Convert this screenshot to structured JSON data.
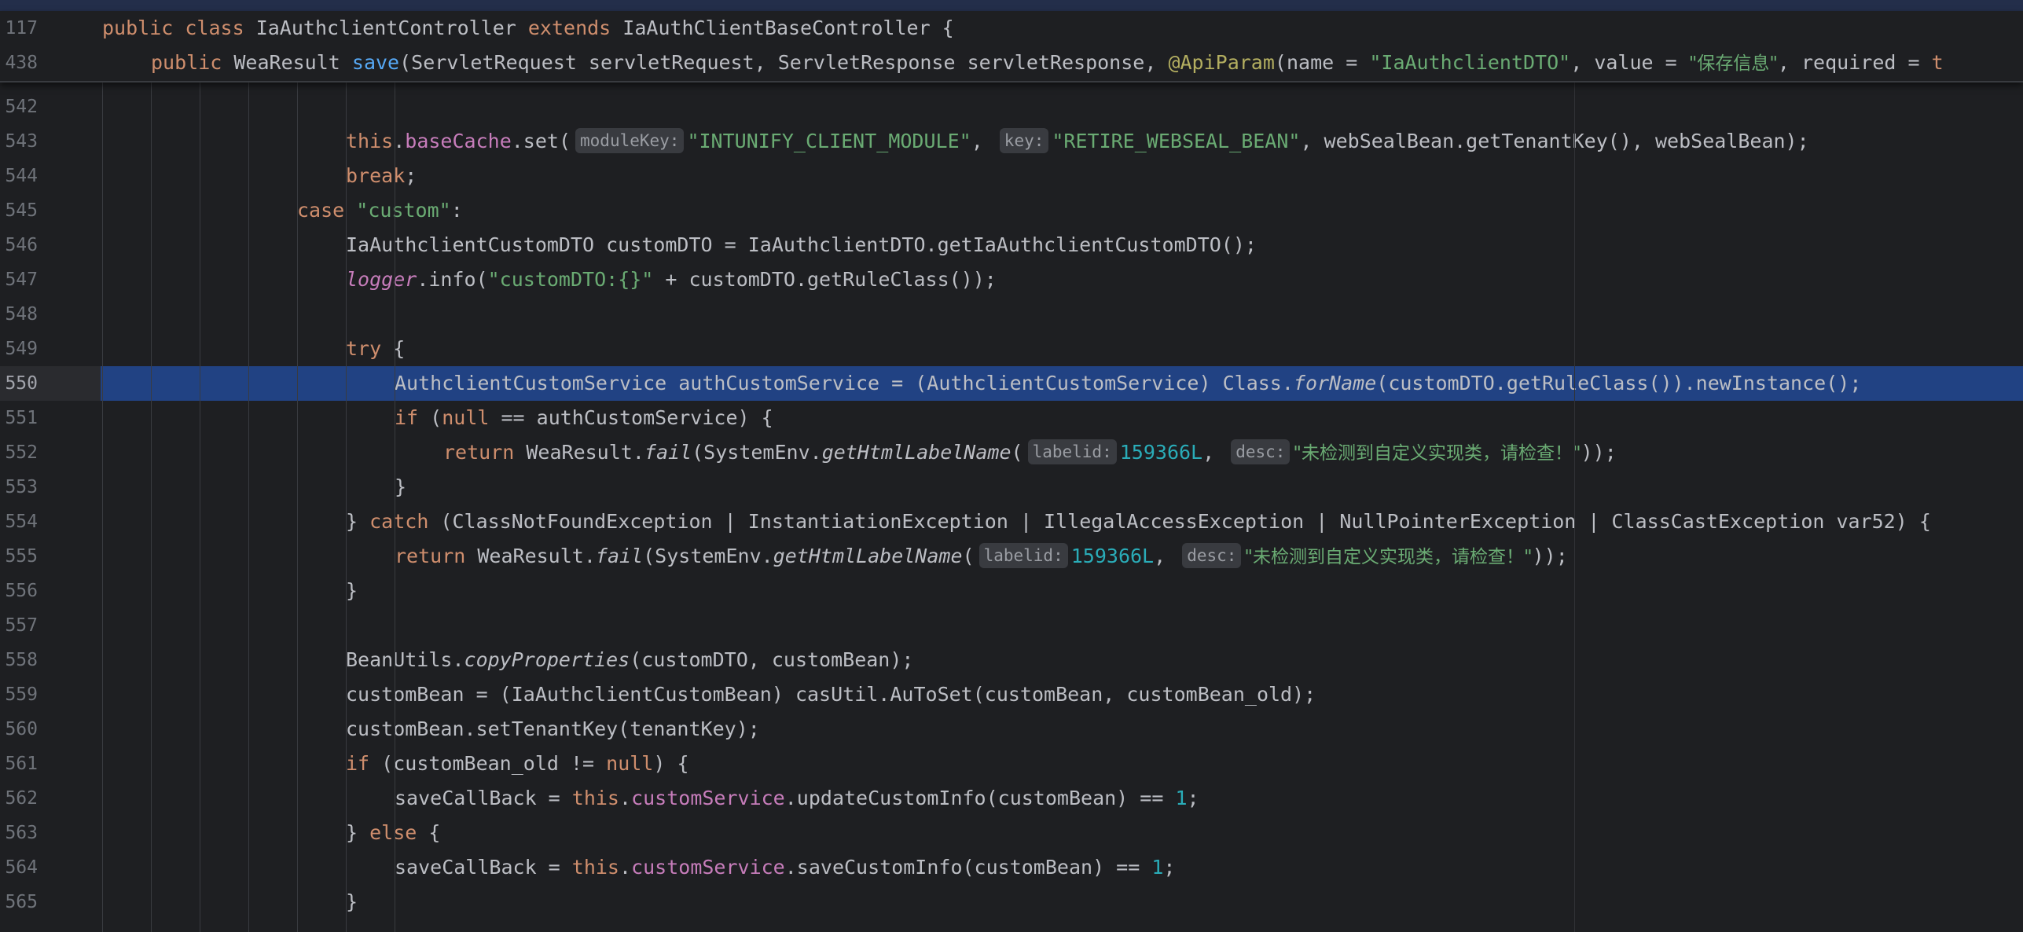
{
  "editor": {
    "sticky": [
      {
        "num": "117",
        "indent": 0,
        "parts": [
          {
            "t": "public",
            "c": "kw"
          },
          {
            "t": " "
          },
          {
            "t": "class",
            "c": "kw"
          },
          {
            "t": " IaAuthclientController "
          },
          {
            "t": "extends",
            "c": "kw"
          },
          {
            "t": " IaAuthClientBaseController {"
          }
        ]
      },
      {
        "num": "438",
        "indent": 1,
        "parts": [
          {
            "t": "public",
            "c": "kw"
          },
          {
            "t": " WeaResult "
          },
          {
            "t": "save",
            "c": "fn"
          },
          {
            "t": "(ServletRequest servletRequest, ServletResponse servletResponse, "
          },
          {
            "t": "@ApiParam",
            "c": "ann"
          },
          {
            "t": "(name = "
          },
          {
            "t": "\"IaAuthclientDTO\"",
            "c": "str"
          },
          {
            "t": ", value = "
          },
          {
            "t": "\"保存信息\"",
            "c": "str cn"
          },
          {
            "t": ", required = "
          },
          {
            "t": "t",
            "c": "kw"
          }
        ]
      }
    ],
    "lines": [
      {
        "num": "542",
        "indent": 0,
        "parts": []
      },
      {
        "num": "543",
        "indent": 5,
        "parts": [
          {
            "t": "this",
            "c": "kw"
          },
          {
            "t": "."
          },
          {
            "t": "baseCache",
            "c": "fld"
          },
          {
            "t": ".set("
          },
          {
            "h": "moduleKey:"
          },
          {
            "t": "\"INTUNIFY_CLIENT_MODULE\"",
            "c": "str"
          },
          {
            "t": ", "
          },
          {
            "h": "key:"
          },
          {
            "t": "\"RETIRE_WEBSEAL_BEAN\"",
            "c": "str"
          },
          {
            "t": ", webSealBean.getTenantKey(), webSealBean);"
          }
        ]
      },
      {
        "num": "544",
        "indent": 5,
        "parts": [
          {
            "t": "break",
            "c": "kw"
          },
          {
            "t": ";"
          }
        ]
      },
      {
        "num": "545",
        "indent": 4,
        "parts": [
          {
            "t": "case",
            "c": "kw"
          },
          {
            "t": " "
          },
          {
            "t": "\"custom\"",
            "c": "str"
          },
          {
            "t": ":"
          }
        ]
      },
      {
        "num": "546",
        "indent": 5,
        "parts": [
          {
            "t": "IaAuthclientCustomDTO customDTO = IaAuthclientDTO.getIaAuthclientCustomDTO();"
          }
        ]
      },
      {
        "num": "547",
        "indent": 5,
        "parts": [
          {
            "t": "logger",
            "c": "fld it"
          },
          {
            "t": ".info("
          },
          {
            "t": "\"customDTO:{}\"",
            "c": "str"
          },
          {
            "t": " + customDTO.getRuleClass());"
          }
        ]
      },
      {
        "num": "548",
        "indent": 0,
        "parts": []
      },
      {
        "num": "549",
        "indent": 5,
        "parts": [
          {
            "t": "try",
            "c": "kw"
          },
          {
            "t": " {"
          }
        ]
      },
      {
        "num": "550",
        "indent": 6,
        "hl": true,
        "parts": [
          {
            "t": "AuthclientCustomService authCustomService = (AuthclientCustomService) Class."
          },
          {
            "t": "forName",
            "c": "it"
          },
          {
            "t": "(customDTO.getRuleClass()).newInstance();"
          }
        ]
      },
      {
        "num": "551",
        "indent": 6,
        "parts": [
          {
            "t": "if",
            "c": "kw"
          },
          {
            "t": " ("
          },
          {
            "t": "null",
            "c": "kw"
          },
          {
            "t": " == authCustomService) {"
          }
        ]
      },
      {
        "num": "552",
        "indent": 7,
        "parts": [
          {
            "t": "return",
            "c": "kw"
          },
          {
            "t": " WeaResult."
          },
          {
            "t": "fail",
            "c": "it"
          },
          {
            "t": "(SystemEnv."
          },
          {
            "t": "getHtmlLabelName",
            "c": "it"
          },
          {
            "t": "("
          },
          {
            "h": "labelid:"
          },
          {
            "t": "159366L",
            "c": "num"
          },
          {
            "t": ", "
          },
          {
            "h": "desc:"
          },
          {
            "t": "\"未检测到自定义实现类，请检查！\"",
            "c": "str cn"
          },
          {
            "t": "));"
          }
        ]
      },
      {
        "num": "553",
        "indent": 6,
        "parts": [
          {
            "t": "}"
          }
        ]
      },
      {
        "num": "554",
        "indent": 5,
        "parts": [
          {
            "t": "} "
          },
          {
            "t": "catch",
            "c": "kw"
          },
          {
            "t": " (ClassNotFoundException | InstantiationException | IllegalAccessException | NullPointerException | ClassCastException var52) {"
          }
        ]
      },
      {
        "num": "555",
        "indent": 6,
        "parts": [
          {
            "t": "return",
            "c": "kw"
          },
          {
            "t": " WeaResult."
          },
          {
            "t": "fail",
            "c": "it"
          },
          {
            "t": "(SystemEnv."
          },
          {
            "t": "getHtmlLabelName",
            "c": "it"
          },
          {
            "t": "("
          },
          {
            "h": "labelid:"
          },
          {
            "t": "159366L",
            "c": "num"
          },
          {
            "t": ", "
          },
          {
            "h": "desc:"
          },
          {
            "t": "\"未检测到自定义实现类，请检查！\"",
            "c": "str cn"
          },
          {
            "t": "));"
          }
        ]
      },
      {
        "num": "556",
        "indent": 5,
        "parts": [
          {
            "t": "}"
          }
        ]
      },
      {
        "num": "557",
        "indent": 0,
        "parts": []
      },
      {
        "num": "558",
        "indent": 5,
        "parts": [
          {
            "t": "BeanUtils."
          },
          {
            "t": "copyProperties",
            "c": "it"
          },
          {
            "t": "(customDTO, customBean);"
          }
        ]
      },
      {
        "num": "559",
        "indent": 5,
        "parts": [
          {
            "t": "customBean = (IaAuthclientCustomBean) casUtil.AuToSet(customBean, customBean_old);"
          }
        ]
      },
      {
        "num": "560",
        "indent": 5,
        "parts": [
          {
            "t": "customBean.setTenantKey(tenantKey);"
          }
        ]
      },
      {
        "num": "561",
        "indent": 5,
        "parts": [
          {
            "t": "if",
            "c": "kw"
          },
          {
            "t": " (customBean_old != "
          },
          {
            "t": "null",
            "c": "kw"
          },
          {
            "t": ") {"
          }
        ]
      },
      {
        "num": "562",
        "indent": 6,
        "parts": [
          {
            "t": "saveCallBack = "
          },
          {
            "t": "this",
            "c": "kw"
          },
          {
            "t": "."
          },
          {
            "t": "customService",
            "c": "fld"
          },
          {
            "t": ".updateCustomInfo(customBean) == "
          },
          {
            "t": "1",
            "c": "num"
          },
          {
            "t": ";"
          }
        ]
      },
      {
        "num": "563",
        "indent": 5,
        "parts": [
          {
            "t": "} "
          },
          {
            "t": "else",
            "c": "kw"
          },
          {
            "t": " {"
          }
        ]
      },
      {
        "num": "564",
        "indent": 6,
        "parts": [
          {
            "t": "saveCallBack = "
          },
          {
            "t": "this",
            "c": "kw"
          },
          {
            "t": "."
          },
          {
            "t": "customService",
            "c": "fld"
          },
          {
            "t": ".saveCustomInfo(customBean) == "
          },
          {
            "t": "1",
            "c": "num"
          },
          {
            "t": ";"
          }
        ]
      },
      {
        "num": "565",
        "indent": 5,
        "parts": [
          {
            "t": "}"
          }
        ]
      }
    ]
  }
}
